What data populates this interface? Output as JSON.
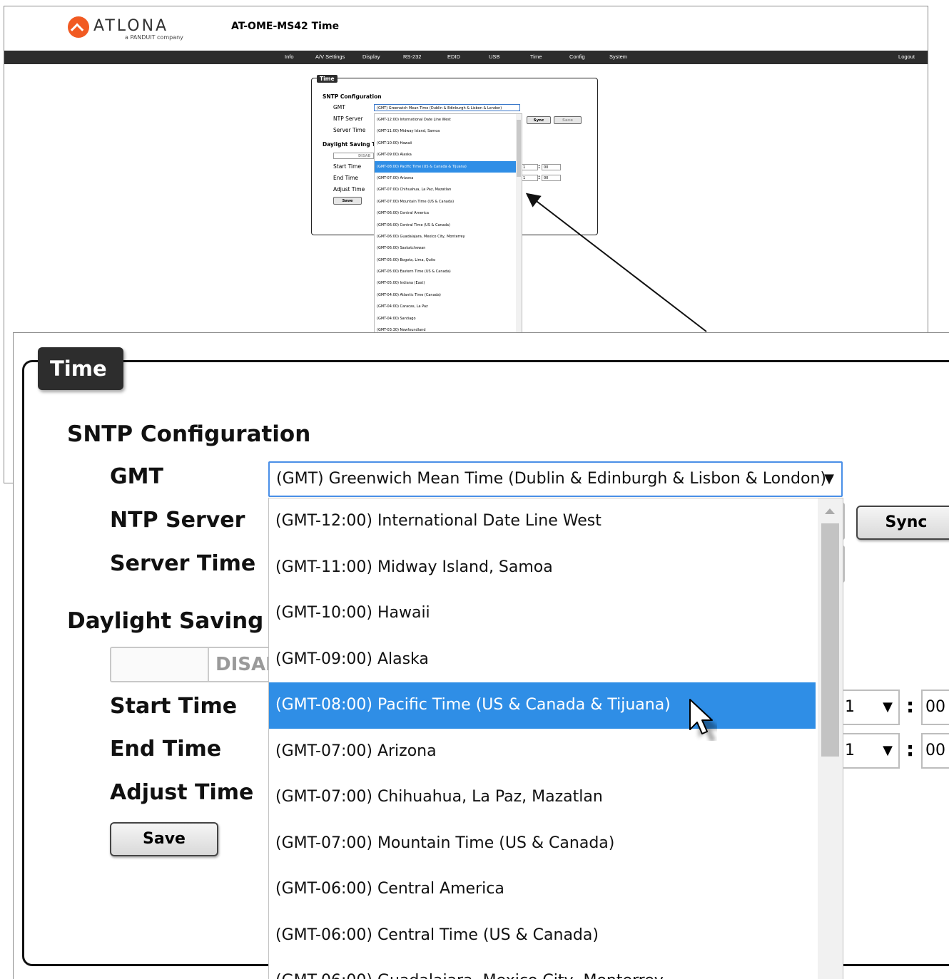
{
  "brand": {
    "name": "ATLONA",
    "tagline": "a PANDUIT company"
  },
  "device_title": "AT-OME-MS42  Time",
  "nav": {
    "items": [
      "Info",
      "A/V Settings",
      "Display",
      "RS-232",
      "EDID",
      "USB",
      "Time",
      "Config",
      "System"
    ],
    "logout": "Logout"
  },
  "panel": {
    "tab": "Time",
    "sntp_heading": "SNTP Configuration",
    "gmt_label": "GMT",
    "ntp_server_label": "NTP Server",
    "server_time_label": "Server Time",
    "dst_heading": "Daylight Saving T",
    "dst_toggle_label": "DISAB",
    "start_time_label": "Start Time",
    "end_time_label": "End Time",
    "adjust_time_label": "Adjust Time",
    "save_label": "Save",
    "sync_label": "Sync",
    "small_save_label": "Save",
    "gmt_selected": "(GMT) Greenwich Mean Time (Dublin & Edinburgh & Lisbon & London)",
    "start_hour": "01",
    "start_minute": "00",
    "end_hour": "01",
    "end_minute": "00",
    "zoom_hour_fragment": "1",
    "zoom_minute_fragment": "00"
  },
  "timezones": [
    "(GMT-12:00) International Date Line West",
    "(GMT-11:00) Midway Island, Samoa",
    "(GMT-10:00) Hawaii",
    "(GMT-09:00) Alaska",
    "(GMT-08:00) Pacific Time (US & Canada & Tijuana)",
    "(GMT-07:00) Arizona",
    "(GMT-07:00) Chihuahua, La Paz, Mazatlan",
    "(GMT-07:00) Mountain Time (US & Canada)",
    "(GMT-06:00) Central America",
    "(GMT-06:00) Central Time (US & Canada)",
    "(GMT-06:00) Guadalajara, Mexico City, Monterrey",
    "(GMT-06:00) Saskatchewan",
    "(GMT-05:00) Bogota, Lima, Quito",
    "(GMT-05:00) Eastern Time (US & Canada)",
    "(GMT-05:00) Indiana (East)",
    "(GMT-04:00) Atlantic Time (Canada)",
    "(GMT-04:00) Caracas, La Paz",
    "(GMT-04:00) Santiago",
    "(GMT-03:30) Newfoundland"
  ],
  "highlighted_index": 4,
  "colors": {
    "accent": "#2f8ee6",
    "navbar": "#2d2d2d",
    "brand": "#f15a22"
  },
  "icons": {
    "dropdown": "caret-down-icon",
    "cursor": "pointer-cursor-icon"
  }
}
